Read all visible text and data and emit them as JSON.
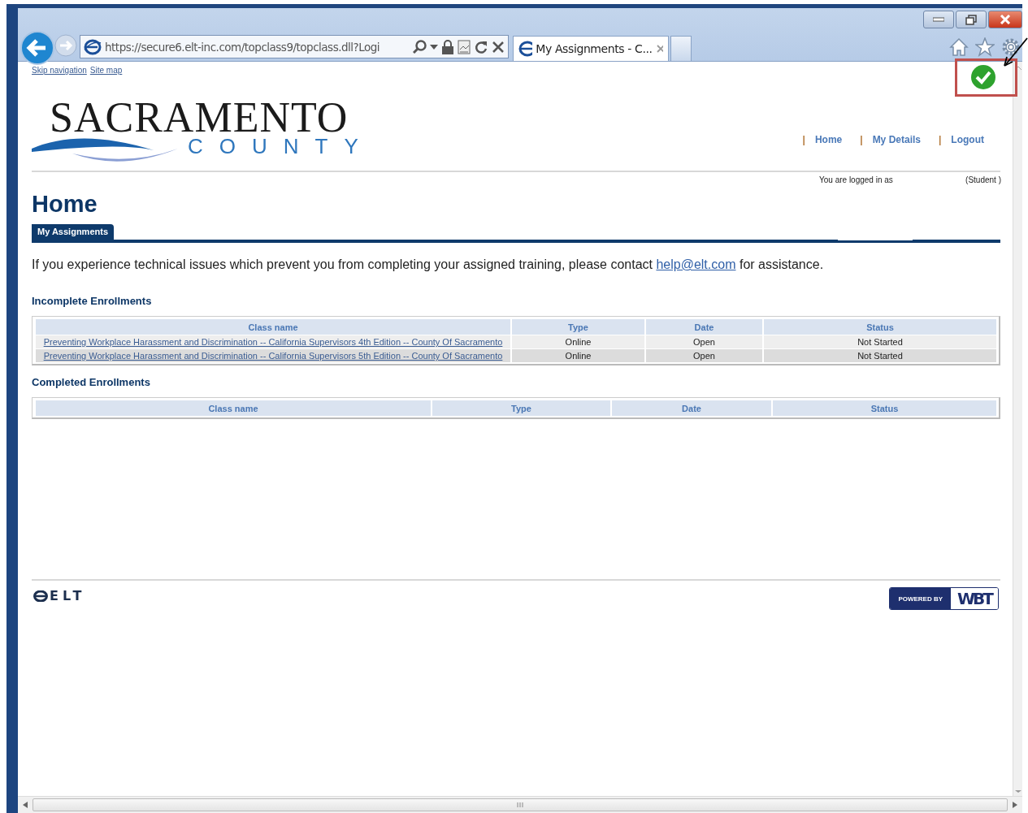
{
  "browser": {
    "address": "https://secure6.elt-inc.com/topclass9/topclass.dll?Logi",
    "tabs": [
      {
        "title": "My Assignments - C...",
        "selected": true
      }
    ]
  },
  "skip_links": [
    "Skip navigation",
    "Site map"
  ],
  "logo": {
    "name": "SACRAMENTO",
    "subtitle": "COUNTY"
  },
  "nav": [
    {
      "separator": "|",
      "label": "Home"
    },
    {
      "separator": "|",
      "label": "My Details"
    },
    {
      "separator": "|",
      "label": "Logout"
    }
  ],
  "login_status": {
    "text": "You are logged in as",
    "role": "(Student )"
  },
  "page_title": "Home",
  "tabs": [
    {
      "label": "My Assignments",
      "selected": true
    }
  ],
  "notice": {
    "text_before": "If you experience technical issues which prevent you from completing your assigned training, please contact",
    "link": "help@elt.com",
    "text_after": "for assistance."
  },
  "incomplete": {
    "title": "Incomplete Enrollments",
    "columns": [
      "Class name",
      "Type",
      "Date",
      "Status"
    ],
    "rows": [
      {
        "cells": [
          "Preventing Workplace Harassment and Discrimination -- California Supervisors 4th Edition -- County Of Sacramento",
          "Online",
          "Open",
          "Not Started"
        ]
      },
      {
        "cells": [
          "Preventing Workplace Harassment and Discrimination -- California Supervisors 5th Edition -- County Of Sacramento",
          "Online",
          "Open",
          "Not Started"
        ]
      }
    ]
  },
  "completed": {
    "title": "Completed Enrollments",
    "columns": [
      "Class name",
      "Type",
      "Date",
      "Status"
    ]
  },
  "footer": {
    "logo": "ELT",
    "powered_by": "POWERED BY",
    "brand": "WBT"
  }
}
